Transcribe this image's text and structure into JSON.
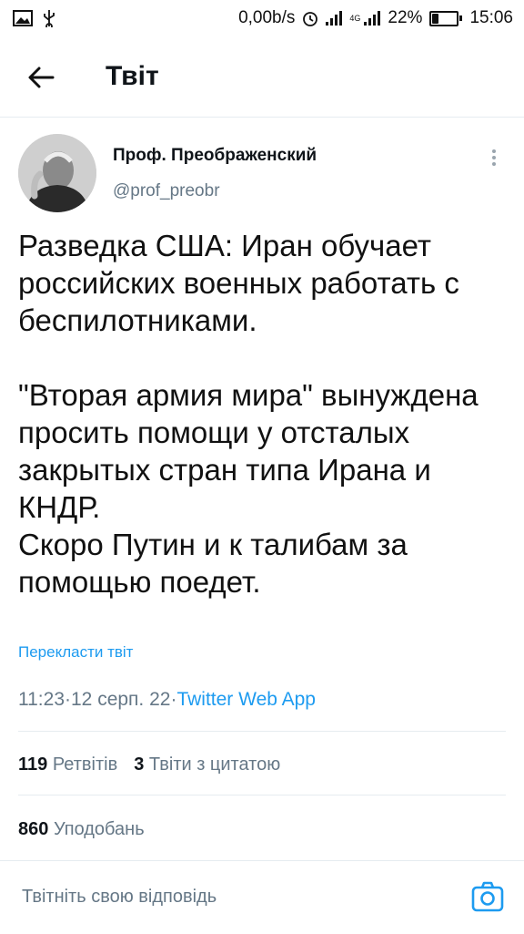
{
  "status_bar": {
    "net_speed": "0,00b/s",
    "network_type": "4G",
    "battery": "22%",
    "battery_level": 0.22,
    "time": "15:06",
    "icons": [
      "image-icon",
      "usb-icon",
      "alarm-icon",
      "signal-icon",
      "signal-4g-icon",
      "battery-icon"
    ]
  },
  "header": {
    "title": "Твіт"
  },
  "tweet": {
    "display_name": "Проф. Преображенский",
    "handle": "@prof_preobr",
    "text": "Разведка США: Иран обучает российских военных работать с беспилотниками.\n\n\"Вторая армия мира\" вынуждена просить помощи у отсталых закрытых стран типа Ирана и КНДР.\nСкоро Путин и к талибам за помощью поедет.",
    "translate_label": "Перекласти твіт",
    "time": "11:23",
    "date": "12 серп. 22",
    "separator": " · ",
    "source_app": "Twitter Web App"
  },
  "stats": {
    "retweets_count": "119",
    "retweets_label": "Ретвітів",
    "quotes_count": "3",
    "quotes_label": "Твіти з цитатою",
    "likes_count": "860",
    "likes_label": "Уподобань"
  },
  "reply": {
    "placeholder": "Твітніть свою відповідь"
  },
  "colors": {
    "accent": "#1d9bf0",
    "secondary_text": "#657786",
    "divider": "#e6ecf0"
  }
}
